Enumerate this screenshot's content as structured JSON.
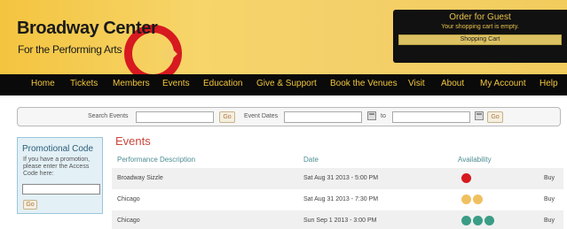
{
  "header": {
    "logo_main_1": "Broadway",
    "logo_main_2": "Center",
    "logo_sub": "For the Performing Arts",
    "logo_tm": "™"
  },
  "cart": {
    "title": "Order for Guest",
    "status": "Your shopping cart is empty.",
    "button": "Shopping Cart"
  },
  "nav": {
    "items": [
      "Home",
      "Tickets",
      "Members",
      "Events",
      "Education",
      "Give & Support",
      "Book the Venues",
      "Visit",
      "About",
      "My Account",
      "Help"
    ]
  },
  "search": {
    "label_events": "Search Events",
    "go": "Go",
    "label_dates": "Event Dates",
    "label_to": "to"
  },
  "promo": {
    "title": "Promotional Code",
    "text": "If you have a promotion, please enter the Access Code here:",
    "go": "Go"
  },
  "events": {
    "title": "Events",
    "columns": [
      "Performance Description",
      "Date",
      "Availability"
    ],
    "rows": [
      {
        "description": "Broadway Sizzle",
        "date": "Sat Aug 31 2013 - 5:00 PM",
        "availability_dots": [
          "#d71920"
        ],
        "buy": "Buy"
      },
      {
        "description": "Chicago",
        "date": "Sat Aug 31 2013 - 7:30 PM",
        "availability_dots": [
          "#f0c060",
          "#f0c060"
        ],
        "buy": "Buy"
      },
      {
        "description": "Chicago",
        "date": "Sun Sep 1 2013 - 3:00 PM",
        "availability_dots": [
          "#3a9d86",
          "#3a9d86",
          "#3a9d86"
        ],
        "buy": "Buy"
      }
    ]
  },
  "colors": {
    "brand_red": "#d71920",
    "nav_text": "#f1c63e",
    "events_title": "#c9473c",
    "column_header": "#4d8d92"
  }
}
